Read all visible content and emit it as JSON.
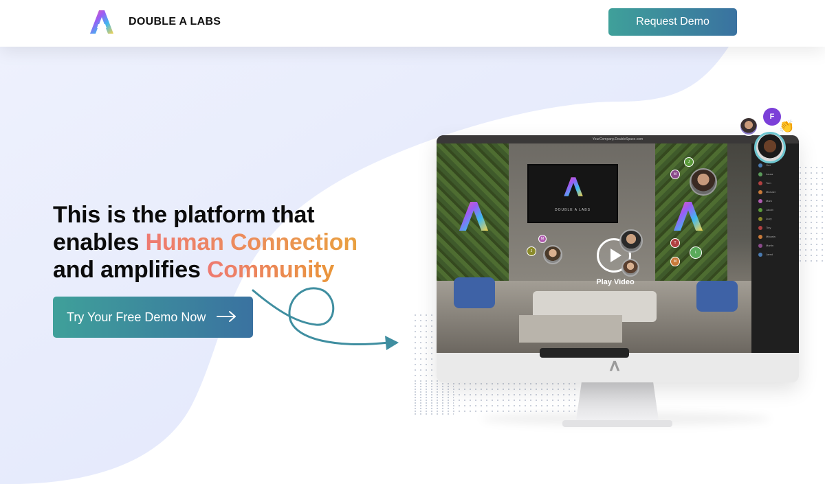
{
  "nav": {
    "brand": "DOUBLE A LABS",
    "request_demo_label": "Request Demo"
  },
  "hero": {
    "headline_line1": "This is the platform that",
    "headline_line2_prefix": "enables ",
    "headline_line2_highlight": "Human Connection",
    "headline_line3_prefix": "and amplifies ",
    "headline_line3_highlight": "Community",
    "cta_label": "Try Your Free Demo Now"
  },
  "monitor": {
    "url": "YourCompany.DoubleSpace.com",
    "tv_brand": "DOUBLE A LABS",
    "play_label": "Play Video",
    "participants": [
      "You",
      "Laura",
      "Tom",
      "Michael",
      "Mark",
      "Jacob",
      "Lucy",
      "Tiny",
      "Mikaela",
      "Martin",
      "Jared"
    ],
    "bubble_letters": [
      "J",
      "M",
      "M",
      "J",
      "T",
      "L",
      "M"
    ]
  },
  "avatars": {
    "letter_avatar": "F",
    "clap_emoji": "👏"
  },
  "colors": {
    "accent_start": "#3fa09a",
    "accent_end": "#3a72a0",
    "highlight_start": "#ee7a72",
    "highlight_end": "#e9a040",
    "blob": "#e4e9fb"
  },
  "icons": {
    "logo": "double-a-logo-icon",
    "cta_arrow": "arrow-right-icon",
    "play": "play-icon"
  }
}
